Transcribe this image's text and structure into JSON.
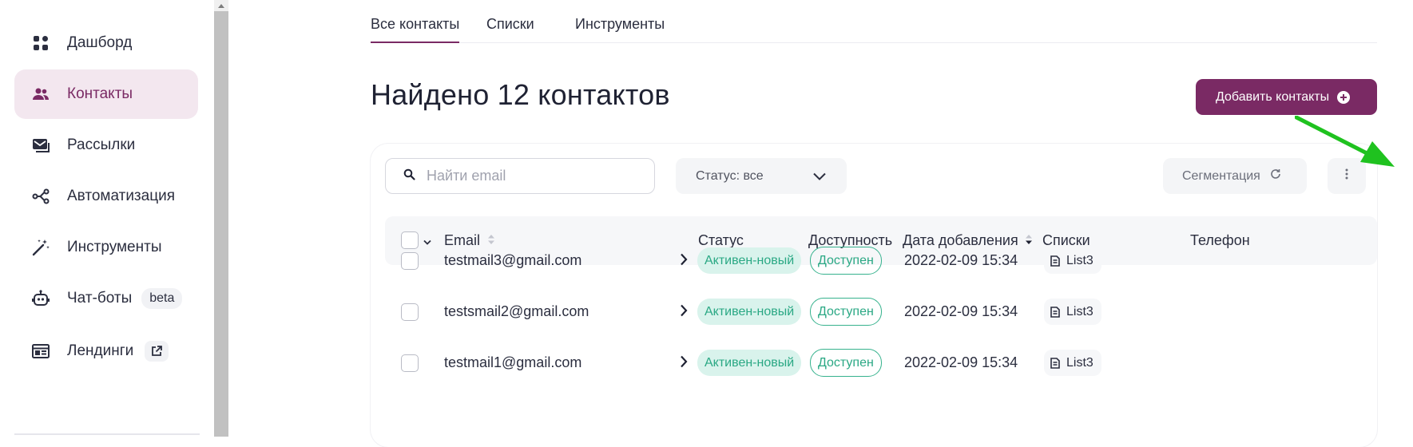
{
  "sidebar": {
    "items": [
      {
        "label": "Дашборд",
        "icon": "dashboard-icon"
      },
      {
        "label": "Контакты",
        "icon": "contacts-icon",
        "active": true
      },
      {
        "label": "Рассылки",
        "icon": "mailings-icon"
      },
      {
        "label": "Автоматизация",
        "icon": "automation-icon"
      },
      {
        "label": "Инструменты",
        "icon": "magic-wand-icon"
      },
      {
        "label": "Чат-боты",
        "icon": "robot-icon",
        "badge": "beta"
      },
      {
        "label": "Лендинги",
        "icon": "landing-icon",
        "external_icon": "external-link-icon"
      }
    ]
  },
  "tabs": [
    {
      "label": "Все контакты",
      "active": true
    },
    {
      "label": "Списки"
    },
    {
      "label": "Инструменты"
    }
  ],
  "header": {
    "title": "Найдено 12 контактов",
    "add_button_label": "Добавить контакты"
  },
  "toolbar": {
    "search_placeholder": "Найти email",
    "status_filter_label": "Статус: все",
    "segmentation_label": "Сегментация"
  },
  "table": {
    "columns": [
      "Email",
      "Статус",
      "Доступность",
      "Дата добавления",
      "Списки",
      "Телефон"
    ],
    "rows": [
      {
        "email": "testmail3@gmail.com",
        "status": "Активен-новый",
        "availability": "Доступен",
        "date": "2022-02-09 15:34",
        "list": "List3"
      },
      {
        "email": "testsmail2@gmail.com",
        "status": "Активен-новый",
        "availability": "Доступен",
        "date": "2022-02-09 15:34",
        "list": "List3"
      },
      {
        "email": "testmail1@gmail.com",
        "status": "Активен-новый",
        "availability": "Доступен",
        "date": "2022-02-09 15:34",
        "list": "List3"
      }
    ]
  },
  "colors": {
    "brand": "#7a2a64",
    "active_nav_bg": "#f3e7ef",
    "status_green": "#2aa884",
    "annotation_arrow": "#1fc21f"
  }
}
